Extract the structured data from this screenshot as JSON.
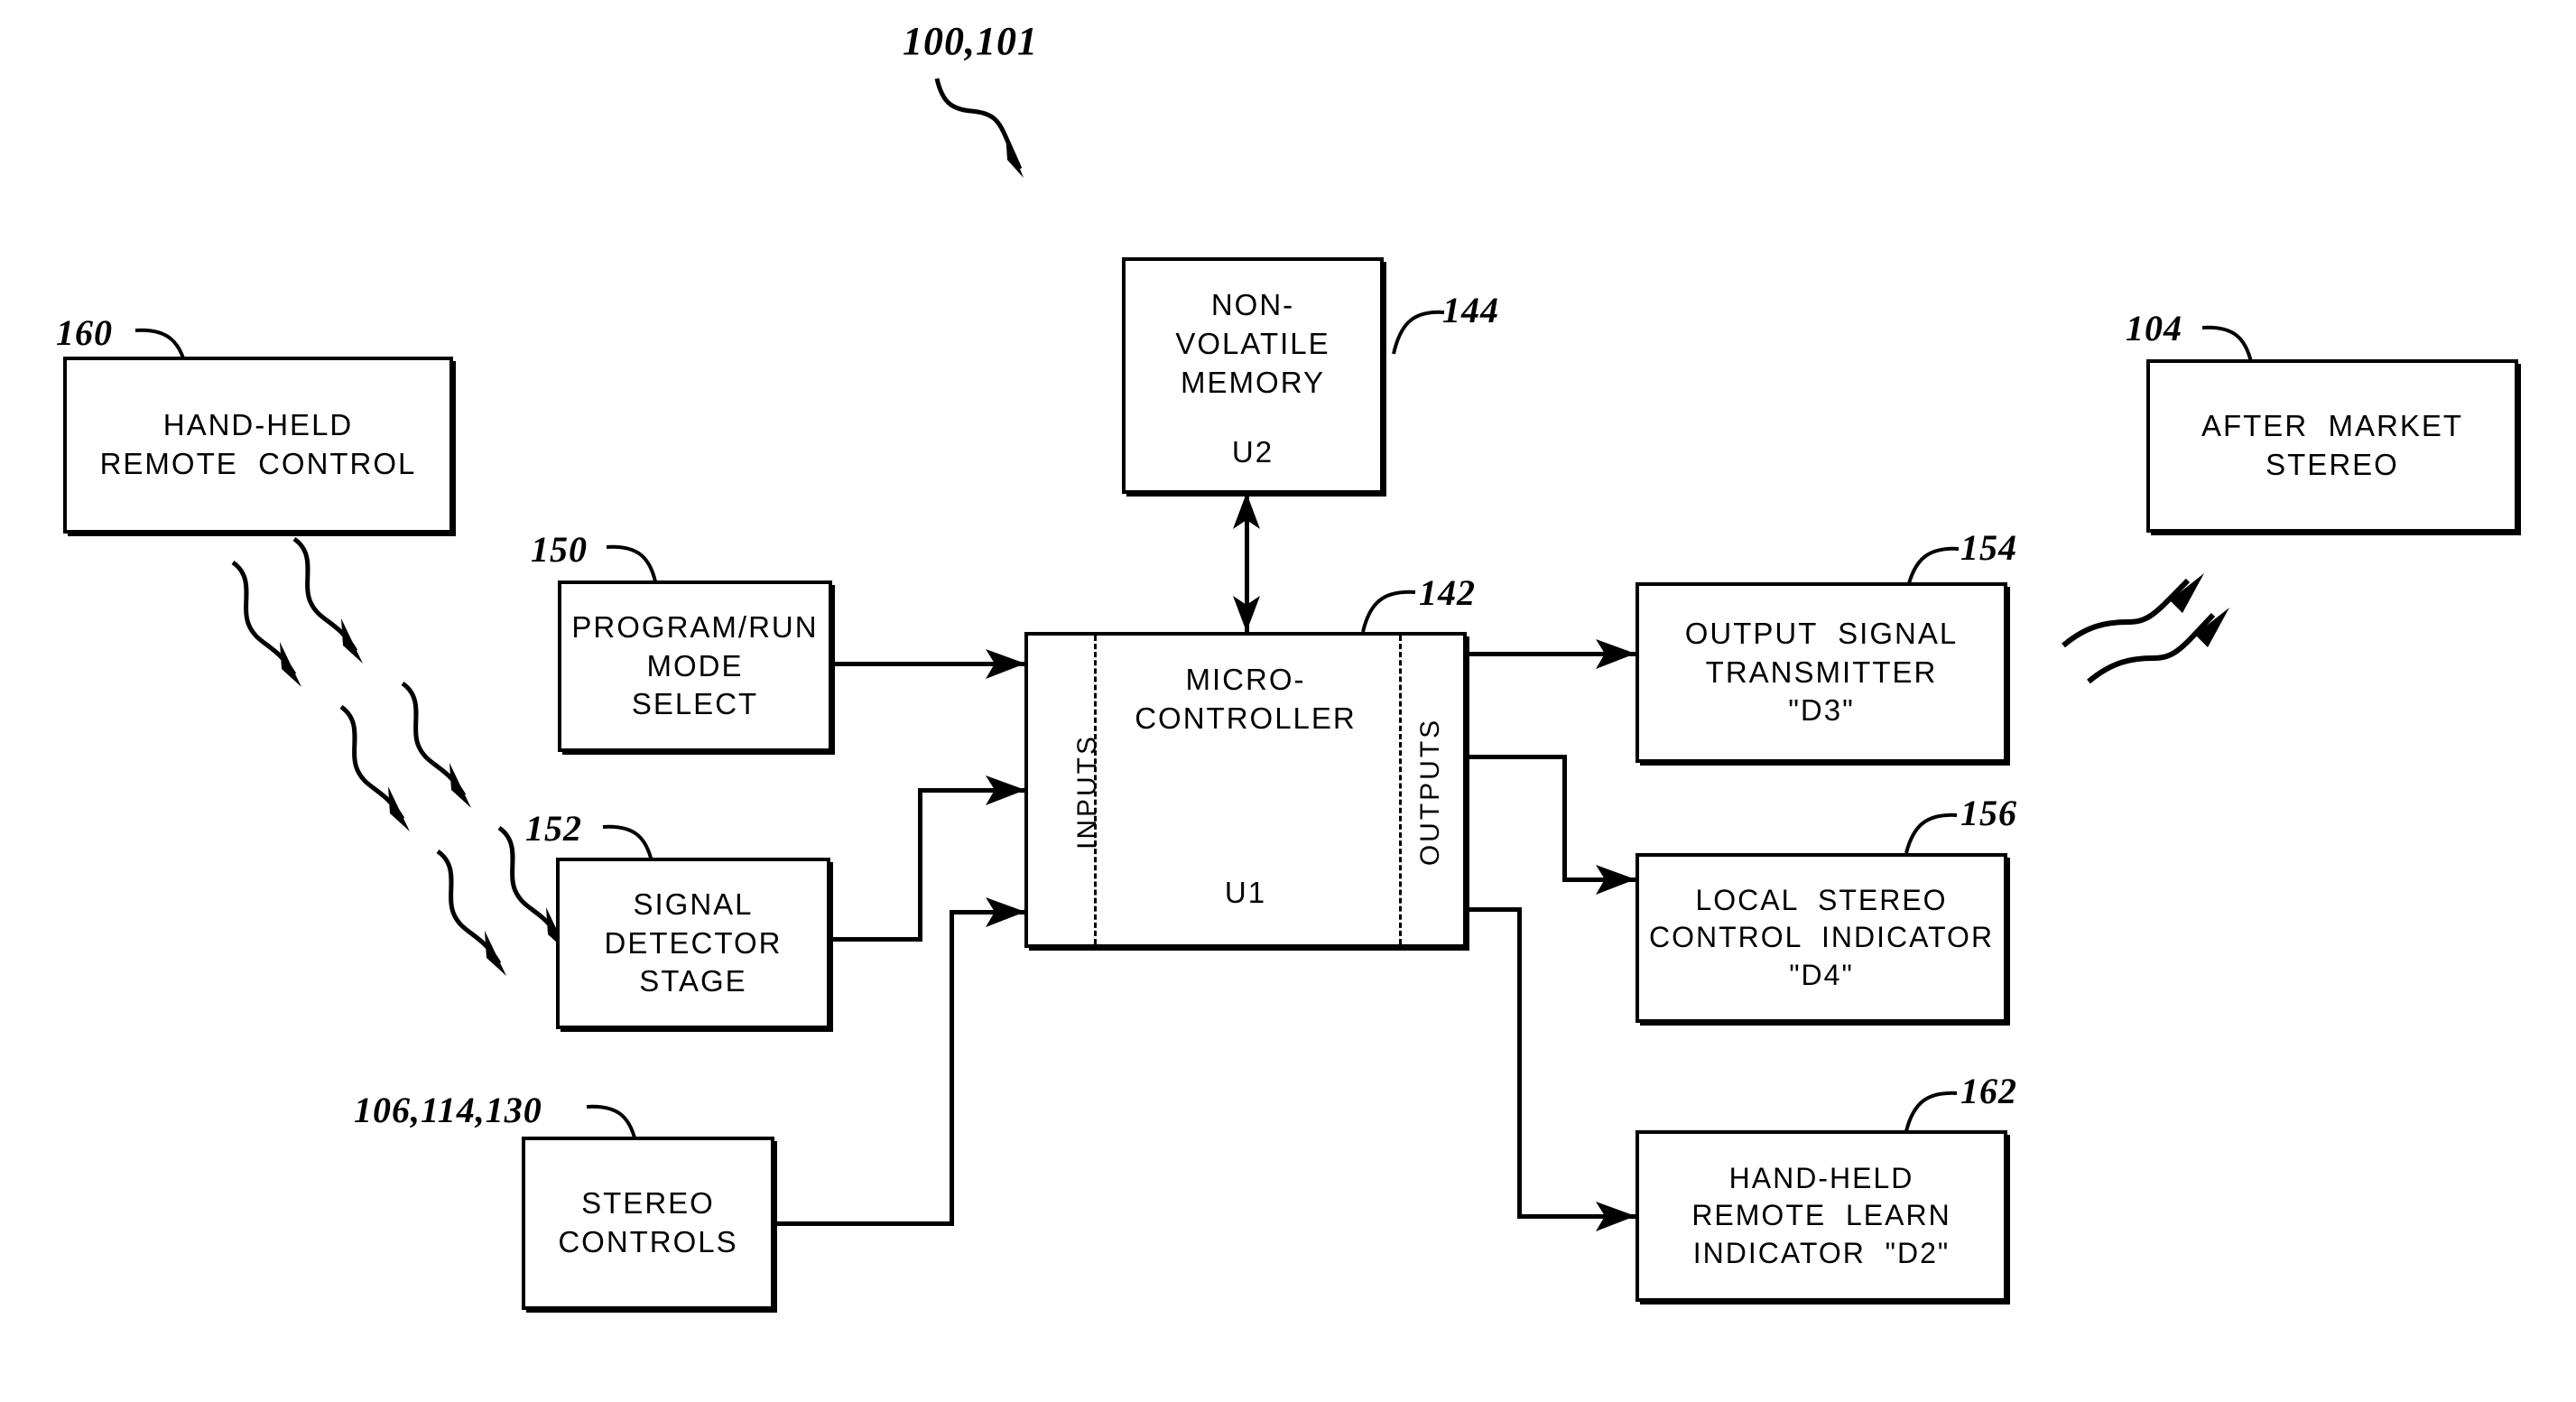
{
  "figure": {
    "title_ref": "100,101",
    "boxes": [
      {
        "id": "hand-held-remote-control",
        "ref": "160",
        "lines": [
          "HAND-HELD",
          "REMOTE  CONTROL"
        ]
      },
      {
        "id": "program-run-mode-select",
        "ref": "150",
        "lines": [
          "PROGRAM/RUN",
          "MODE",
          "SELECT"
        ]
      },
      {
        "id": "signal-detector-stage",
        "ref": "152",
        "lines": [
          "SIGNAL",
          "DETECTOR",
          "STAGE"
        ]
      },
      {
        "id": "stereo-controls",
        "ref": "106,114,130",
        "lines": [
          "STEREO",
          "CONTROLS"
        ]
      },
      {
        "id": "non-volatile-memory",
        "ref": "144",
        "lines": [
          "NON-",
          "VOLATILE",
          "MEMORY"
        ],
        "designator": "U2"
      },
      {
        "id": "micro-controller",
        "ref": "142",
        "lines": [
          "MICRO-",
          "CONTROLLER"
        ],
        "designator": "U1",
        "left_band_label": "INPUTS",
        "right_band_label": "OUTPUTS"
      },
      {
        "id": "output-signal-transmitter",
        "ref": "154",
        "lines": [
          "OUTPUT  SIGNAL",
          "TRANSMITTER",
          "\"D3\""
        ]
      },
      {
        "id": "local-stereo-control-indicator",
        "ref": "156",
        "lines": [
          "LOCAL  STEREO",
          "CONTROL  INDICATOR",
          "\"D4\""
        ]
      },
      {
        "id": "hand-held-remote-learn-indicator",
        "ref": "162",
        "lines": [
          "HAND-HELD",
          "REMOTE  LEARN",
          "INDICATOR  \"D2\""
        ]
      },
      {
        "id": "after-market-stereo",
        "ref": "104",
        "lines": [
          "AFTER  MARKET",
          "STEREO"
        ]
      }
    ]
  },
  "colors": {
    "ink": "#000000",
    "paper": "#ffffff"
  }
}
